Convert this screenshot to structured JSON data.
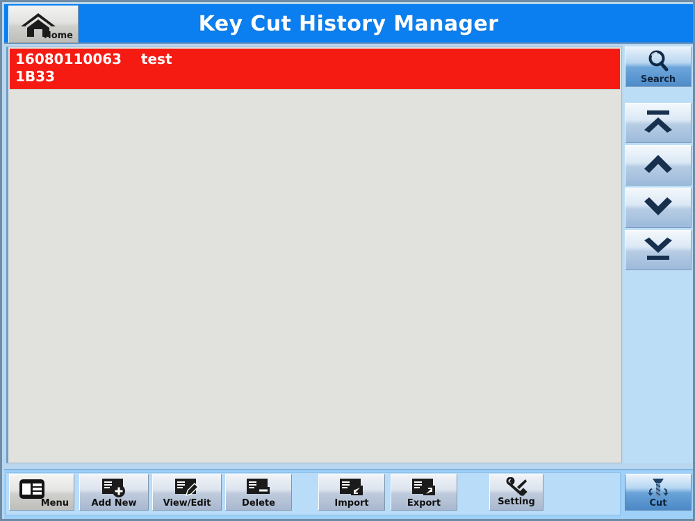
{
  "window": {
    "title": "Key Cut History Manager",
    "accent_blue": "#0b7ff0",
    "frame_color": "#6f8ca6",
    "selected_row_color": "#f51b13",
    "list_background": "#e1e1dd",
    "sidebar_background": "#bcddf6"
  },
  "home_button": {
    "label": "Home",
    "icon": "home-icon"
  },
  "list": {
    "rows": [
      {
        "id": "16080110063",
        "name": "test",
        "line1": "16080110063    test",
        "line2": "1B33",
        "selected": true
      }
    ]
  },
  "sidebar": {
    "buttons": [
      {
        "name": "search",
        "label": "Search",
        "icon": "magnifier-icon",
        "style": "blue"
      },
      {
        "name": "first",
        "label": "",
        "icon": "scroll-top-icon",
        "style": "silver"
      },
      {
        "name": "prev",
        "label": "",
        "icon": "chevron-up-icon",
        "style": "silver"
      },
      {
        "name": "next",
        "label": "",
        "icon": "chevron-down-icon",
        "style": "silver"
      },
      {
        "name": "last",
        "label": "",
        "icon": "scroll-bottom-icon",
        "style": "silver"
      }
    ]
  },
  "toolbar": {
    "menu_label": "Menu",
    "add_new_label": "Add New",
    "view_edit_label": "View/Edit",
    "delete_label": "Delete",
    "import_label": "Import",
    "export_label": "Export",
    "setting_label": "Setting",
    "cut_label": "Cut",
    "icons": {
      "menu": "menu-panel-icon",
      "add_new": "file-add-icon",
      "view_edit": "file-edit-icon",
      "delete": "file-remove-icon",
      "import": "file-import-icon",
      "export": "file-export-icon",
      "setting": "tools-icon",
      "cut": "drill-bit-icon"
    }
  }
}
